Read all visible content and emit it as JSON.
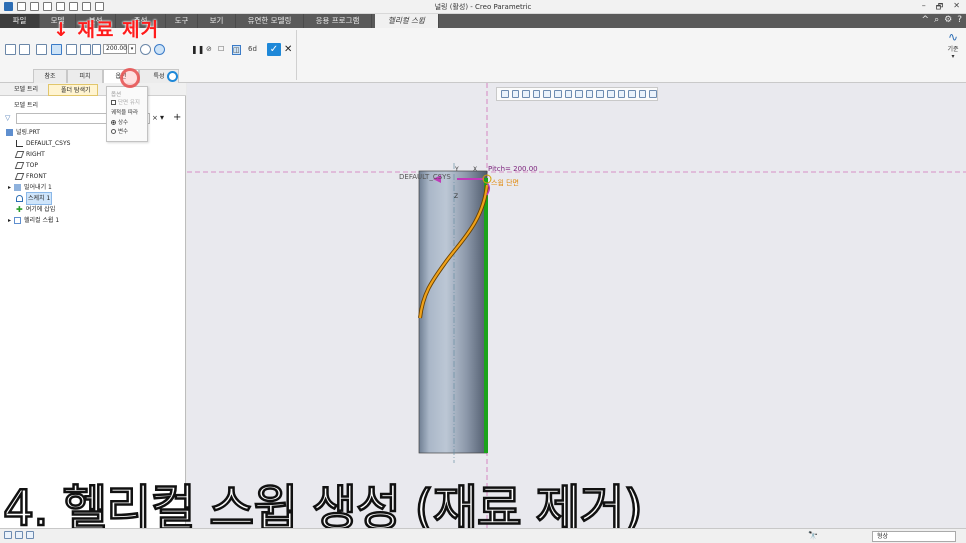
{
  "window": {
    "title": "널링 (활성) - Creo Parametric",
    "controls": [
      "–",
      "🗗",
      "✕"
    ]
  },
  "menu": {
    "tabs": [
      "파일",
      "모델",
      "분석",
      "주석",
      "도구",
      "보기",
      "유연한 모델링",
      "응용 프로그램",
      "헬리컬 스윕"
    ],
    "active_tab": "헬리컬 스윕"
  },
  "ribbon": {
    "pitch_value": "200.00",
    "datum_label": "기준",
    "datum_dropdown": "▾"
  },
  "annotation": {
    "red_label": "↓ 재료 제거",
    "caption": "4. 헬리컬 스윕 생성 (재료 제거)"
  },
  "subtabs": [
    "참조",
    "피치",
    "옵션",
    "특성"
  ],
  "popup": {
    "title": "옵션",
    "merge_label": "단면 유지",
    "section_label": "궤적을 따라",
    "radio_constant": "상수",
    "radio_variable": "변수"
  },
  "left_pane": {
    "tabs": [
      "모델 트리",
      "폴더 탐색기",
      "즐겨찾기"
    ],
    "header": "모델 트리",
    "tree": [
      {
        "label": "널링.PRT",
        "icon": "part-icon"
      },
      {
        "label": "DEFAULT_CSYS",
        "icon": "csys-icon"
      },
      {
        "label": "RIGHT",
        "icon": "datum-plane-icon"
      },
      {
        "label": "TOP",
        "icon": "datum-plane-icon"
      },
      {
        "label": "FRONT",
        "icon": "datum-plane-icon"
      },
      {
        "label": "밀어내기 1",
        "icon": "extrude-icon"
      },
      {
        "label": "스케치 1",
        "icon": "sketch-icon"
      },
      {
        "label": "여기에 삽입",
        "icon": "insert-here-icon"
      },
      {
        "label": "헬리컬 스윕 1",
        "icon": "helical-sweep-icon"
      }
    ]
  },
  "viewport": {
    "csys_label": "DEFAULT_CSYS",
    "pitch_label": "Pitch= 200.00",
    "section_label": "스윕 단면",
    "axis_x": "X",
    "axis_y": "Y",
    "axis_z": "Z"
  },
  "status": {
    "filter_value": "형상"
  }
}
